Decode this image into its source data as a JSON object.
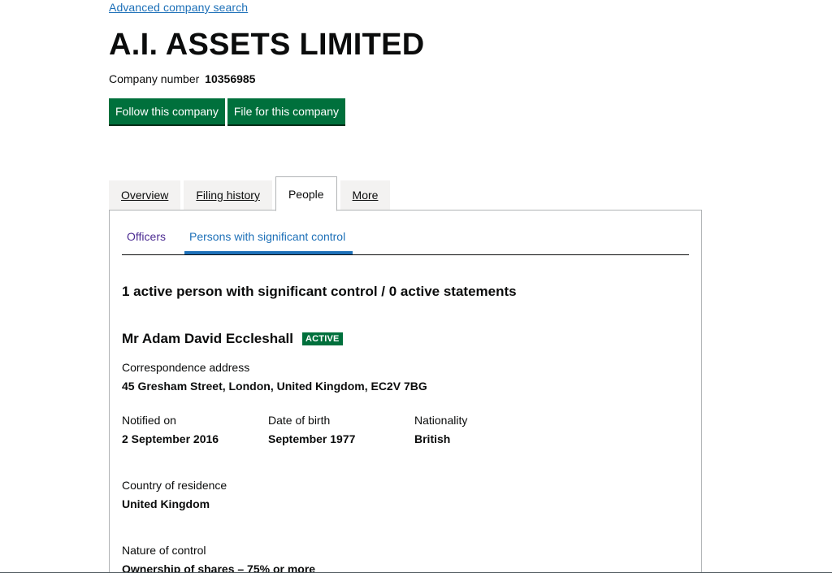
{
  "header": {
    "search_link": "Advanced company search",
    "company_name": "A.I. ASSETS LIMITED",
    "company_number_label": "Company number",
    "company_number": "10356985"
  },
  "actions": {
    "follow_label": "Follow this company",
    "file_label": "File for this company"
  },
  "tabs": [
    {
      "label": "Overview",
      "active": false
    },
    {
      "label": "Filing history",
      "active": false
    },
    {
      "label": "People",
      "active": true
    },
    {
      "label": "More",
      "active": false
    }
  ],
  "subtabs": {
    "officers": "Officers",
    "psc": "Persons with significant control"
  },
  "psc_summary": "1 active person with significant control / 0 active statements",
  "person": {
    "name": "Mr Adam David Eccleshall",
    "status": "ACTIVE",
    "correspondence_address_label": "Correspondence address",
    "correspondence_address": "45 Gresham Street, London, United Kingdom, EC2V 7BG",
    "notified_on_label": "Notified on",
    "notified_on": "2 September 2016",
    "dob_label": "Date of birth",
    "dob": "September 1977",
    "nationality_label": "Nationality",
    "nationality": "British",
    "residence_label": "Country of residence",
    "residence": "United Kingdom",
    "control_label": "Nature of control",
    "control": "Ownership of shares – 75% or more"
  },
  "colors": {
    "button_green": "#00703c",
    "link_blue": "#1d70b8",
    "visited_purple": "#4c2c92",
    "tab_grey": "#f3f2f1"
  }
}
